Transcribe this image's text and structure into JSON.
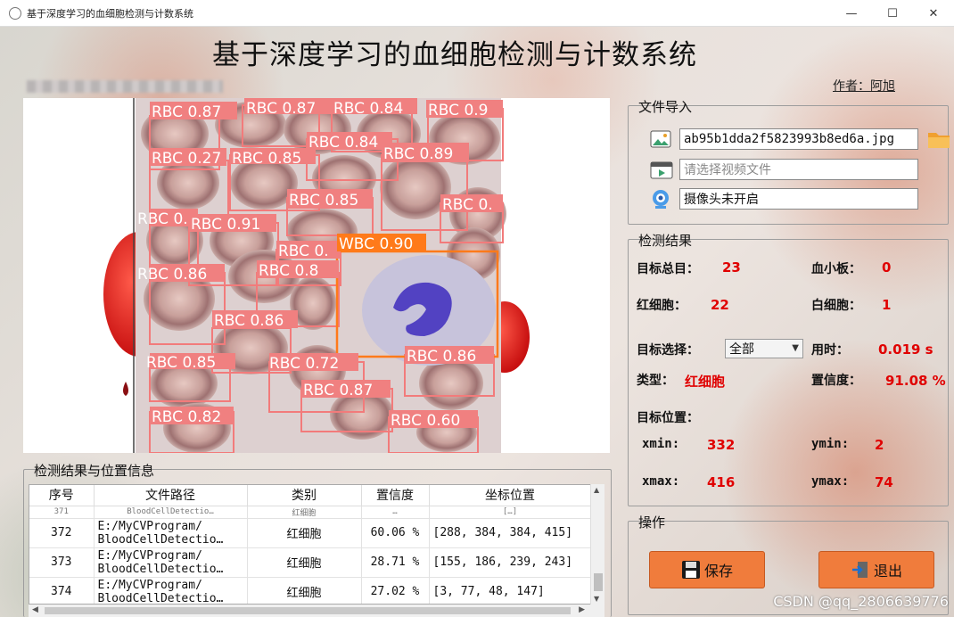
{
  "window": {
    "title": "基于深度学习的血细胞检测与计数系统",
    "minimize": "—",
    "maximize": "☐",
    "close": "✕"
  },
  "header": {
    "title": "基于深度学习的血细胞检测与计数系统",
    "author": "作者：阿旭"
  },
  "detections": [
    {
      "label": "RBC 0.87"
    },
    {
      "label": "RBC 0.87"
    },
    {
      "label": "RBC 0.84"
    },
    {
      "label": "RBC 0.9"
    },
    {
      "label": "RBC 0.84"
    },
    {
      "label": "RBC 0.27"
    },
    {
      "label": "RBC 0.85"
    },
    {
      "label": "RBC 0.89"
    },
    {
      "label": "RBC 0.85"
    },
    {
      "label": "RBC 0."
    },
    {
      "label": "RBC 0."
    },
    {
      "label": "RBC 0.91"
    },
    {
      "label": "RBC 0."
    },
    {
      "label": "WBC 0.90"
    },
    {
      "label": "RBC 0.86"
    },
    {
      "label": "RBC 0.8"
    },
    {
      "label": "RBC 0.86"
    },
    {
      "label": "RBC 0.85"
    },
    {
      "label": "RBC 0.72"
    },
    {
      "label": "RBC 0.86"
    },
    {
      "label": "RBC 0.87"
    },
    {
      "label": "RBC 0.82"
    },
    {
      "label": "RBC 0.60"
    }
  ],
  "file_import": {
    "title": "文件导入",
    "image_path": "ab95b1dda2f5823993b8ed6a.jpg",
    "video_placeholder": "请选择视频文件",
    "camera_status": "摄像头未开启"
  },
  "results": {
    "title": "检测结果",
    "total_label": "目标总目：",
    "total": "23",
    "platelet_label": "血小板：",
    "platelet": "0",
    "rbc_label": "红细胞：",
    "rbc": "22",
    "wbc_label": "白细胞：",
    "wbc": "1",
    "target_select_label": "目标选择：",
    "target_select_value": "全部",
    "time_label": "用时：",
    "time": "0.019 s",
    "type_label": "类型：",
    "type": "红细胞",
    "conf_label": "置信度：",
    "conf": "91.08 %",
    "position_label": "目标位置：",
    "xmin_label": "xmin:",
    "xmin": "332",
    "ymin_label": "ymin:",
    "ymin": "2",
    "xmax_label": "xmax:",
    "xmax": "416",
    "ymax_label": "ymax:",
    "ymax": "74"
  },
  "operations": {
    "title": "操作",
    "save": "保存",
    "exit": "退出"
  },
  "table": {
    "title": "检测结果与位置信息",
    "headers": [
      "序号",
      "文件路径",
      "类别",
      "置信度",
      "坐标位置"
    ],
    "partial_row": [
      "371",
      "BloodCellDetectio…",
      "红细胞",
      "…",
      "[…]"
    ],
    "rows": [
      {
        "id": "372",
        "path1": "E:/MyCVProgram/",
        "path2": "BloodCellDetectio…",
        "cls": "红细胞",
        "conf": "60.06 %",
        "coords": "[288, 384, 384, 415]"
      },
      {
        "id": "373",
        "path1": "E:/MyCVProgram/",
        "path2": "BloodCellDetectio…",
        "cls": "红细胞",
        "conf": "28.71 %",
        "coords": "[155, 186, 239, 243]"
      },
      {
        "id": "374",
        "path1": "E:/MyCVProgram/",
        "path2": "BloodCellDetectio…",
        "cls": "红细胞",
        "conf": "27.02 %",
        "coords": "[3, 77, 48, 147]"
      }
    ]
  },
  "watermark": "CSDN @qq_2806639776"
}
